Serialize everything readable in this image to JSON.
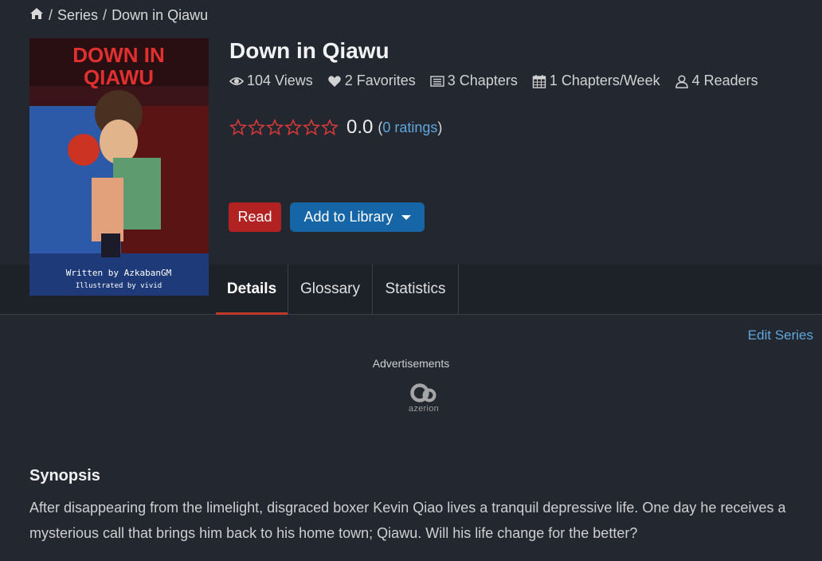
{
  "breadcrumb": {
    "home_icon": "home-icon",
    "separator": "/",
    "series": "Series",
    "current": "Down in Qiawu"
  },
  "cover": {
    "title_lines": [
      "DOWN IN",
      "QIAWU"
    ],
    "written_by": "Written by AzkabanGM",
    "illustrated_by": "Illustrated by vivid"
  },
  "series": {
    "title": "Down in Qiawu",
    "stats": {
      "views": "104 Views",
      "favorites": "2 Favorites",
      "chapters": "3 Chapters",
      "per_week": "1 Chapters/Week",
      "readers": "4 Readers"
    },
    "rating": {
      "value": "0.0",
      "open_paren": "(",
      "count_link": "0 ratings",
      "close_paren": ")",
      "stars_filled": 0,
      "stars_total": 6
    }
  },
  "buttons": {
    "read": "Read",
    "add_to_library": "Add to Library"
  },
  "tabs": [
    {
      "label": "Details",
      "active": true
    },
    {
      "label": "Glossary",
      "active": false
    },
    {
      "label": "Statistics",
      "active": false
    }
  ],
  "edit_series": "Edit Series",
  "ads": {
    "label": "Advertisements",
    "brand": "azerion"
  },
  "synopsis": {
    "heading": "Synopsis",
    "text": "After disappearing from the limelight, disgraced boxer Kevin Qiao lives a tranquil depressive life. One day he receives a mysterious call that brings him back to his home town; Qiawu. Will his life change for the better?"
  },
  "colors": {
    "background": "#23272f",
    "tabbar": "#1d2128",
    "read_button": "#b22222",
    "library_button": "#1565a7",
    "link": "#5fa6dc",
    "star_outline": "#d83a3a",
    "active_tab_underline": "#c0392b"
  }
}
